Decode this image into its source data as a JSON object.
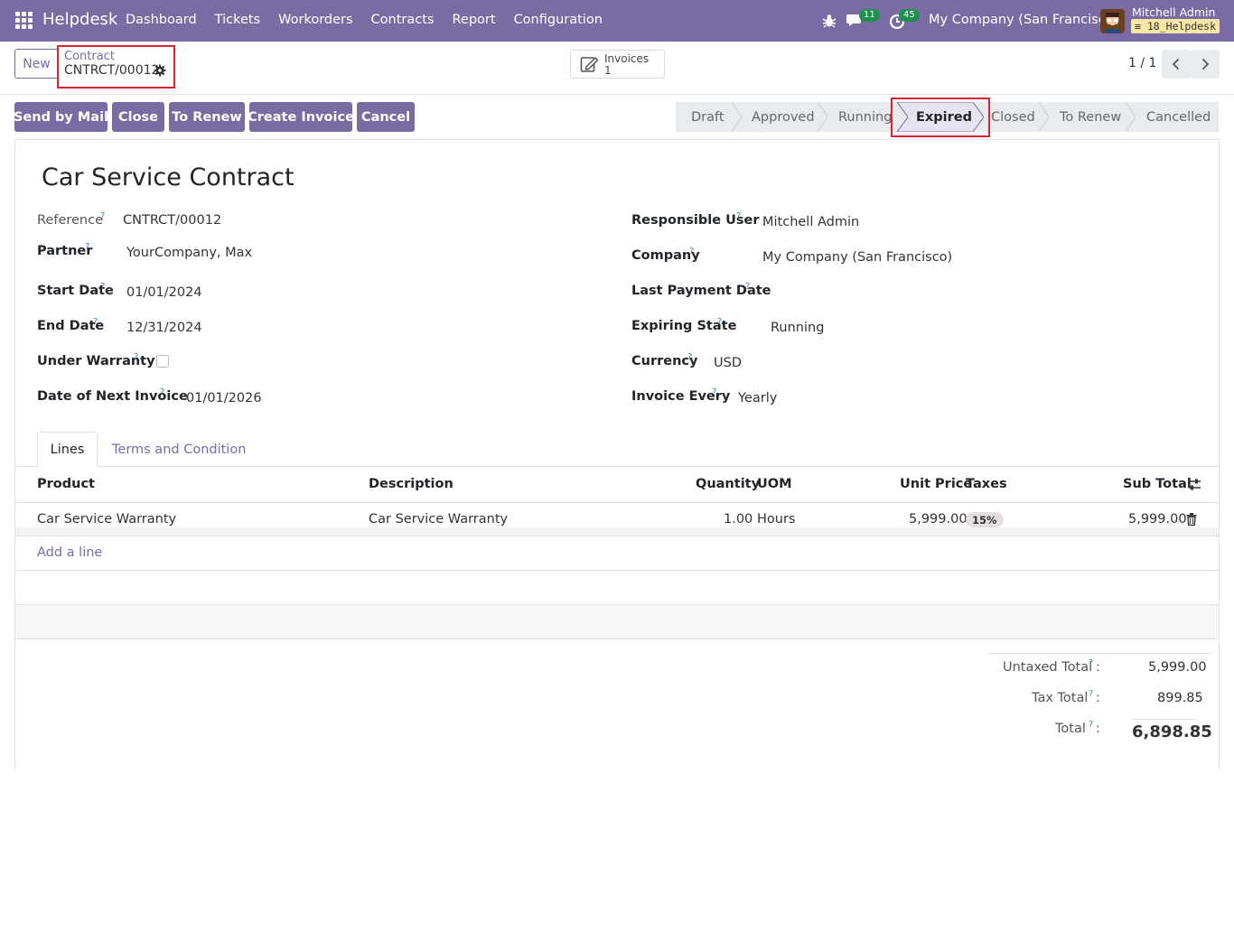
{
  "navbar": {
    "brand": "Helpdesk",
    "menu": [
      "Dashboard",
      "Tickets",
      "Workorders",
      "Contracts",
      "Report",
      "Configuration"
    ],
    "chat_count": "11",
    "activity_count": "45",
    "company": "My Company (San Francisco)",
    "user": "Mitchell Admin",
    "database": "18_Helpdesk"
  },
  "control": {
    "new_label": "New",
    "breadcrumb_parent": "Contract",
    "breadcrumb_current": "CNTRCT/00012",
    "smart_button": {
      "label": "Invoices",
      "count": "1"
    },
    "pager": "1 / 1"
  },
  "actions": [
    "Send by Mail",
    "Close",
    "To Renew",
    "Create Invoice",
    "Cancel"
  ],
  "stages": {
    "items": [
      "Draft",
      "Approved",
      "Running",
      "Expired",
      "Closed",
      "To Renew",
      "Cancelled"
    ],
    "active": "Expired"
  },
  "form": {
    "title": "Car Service Contract",
    "fields": {
      "reference": {
        "label": "Reference",
        "value": "CNTRCT/00012"
      },
      "partner": {
        "label": "Partner",
        "value": "YourCompany, Max"
      },
      "start_date": {
        "label": "Start Date",
        "value": "01/01/2024"
      },
      "end_date": {
        "label": "End Date",
        "value": "12/31/2024"
      },
      "under_warranty": {
        "label": "Under Warranty",
        "checked": false
      },
      "next_invoice": {
        "label": "Date of Next Invoice",
        "value": "01/01/2026"
      },
      "responsible": {
        "label": "Responsible User",
        "value": "Mitchell Admin"
      },
      "company": {
        "label": "Company",
        "value": "My Company (San Francisco)"
      },
      "last_payment": {
        "label": "Last Payment Date",
        "value": ""
      },
      "expiring_state": {
        "label": "Expiring State",
        "value": "Running"
      },
      "currency": {
        "label": "Currency",
        "value": "USD"
      },
      "invoice_every": {
        "label": "Invoice Every",
        "value": "Yearly"
      }
    },
    "help_mark": "?"
  },
  "tabs": [
    "Lines",
    "Terms and Condition"
  ],
  "lines": {
    "columns": [
      "Product",
      "Description",
      "Quantity",
      "UOM",
      "Unit Price",
      "Taxes",
      "Sub Total"
    ],
    "rows": [
      {
        "product": "Car Service Warranty",
        "description": "Car Service Warranty",
        "quantity": "1.00",
        "uom": "Hours",
        "unit_price": "5,999.00",
        "taxes": "15%",
        "subtotal": "5,999.00"
      }
    ],
    "add_line": "Add a line"
  },
  "totals": {
    "untaxed_label": "Untaxed Total",
    "untaxed": "5,999.00",
    "tax_label": "Tax Total",
    "tax": "899.85",
    "total_label": "Total",
    "total": "6,898.85",
    "colon": ":"
  },
  "colors": {
    "brand": "#7a6ba3",
    "highlight": "#d9232e",
    "badge": "#1f8f4e"
  }
}
